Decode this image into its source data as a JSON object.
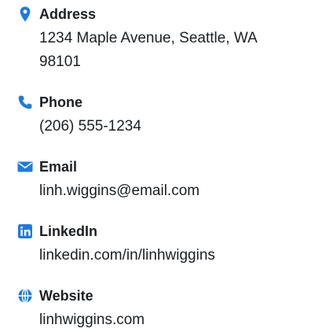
{
  "accent_color": "#1c7be0",
  "contacts": [
    {
      "icon": "map-pin-icon",
      "label": "Address",
      "value": "1234 Maple Avenue, Seattle, WA 98101"
    },
    {
      "icon": "phone-icon",
      "label": "Phone",
      "value": "(206) 555-1234"
    },
    {
      "icon": "envelope-icon",
      "label": "Email",
      "value": "linh.wiggins@email.com"
    },
    {
      "icon": "linkedin-icon",
      "label": "LinkedIn",
      "value": "linkedin.com/in/linhwiggins"
    },
    {
      "icon": "globe-icon",
      "label": "Website",
      "value": "linhwiggins.com"
    }
  ]
}
